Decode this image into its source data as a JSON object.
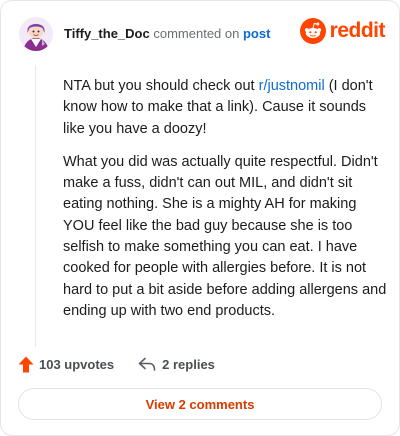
{
  "comment": {
    "username": "Tiffy_the_Doc",
    "verb": "commented on",
    "target": "post",
    "paragraph1_pre": "NTA but you should check out ",
    "paragraph1_link": "r/justnomil",
    "paragraph1_post": " (I don't know how to make that a link). Cause it sounds like you have a doozy!",
    "paragraph2": "What you did was actually quite respectful. Didn't make a fuss, didn't can out MIL, and didn't sit eating nothing. She is a mighty AH for making YOU feel like the bad guy because she is too selfish to make something you can eat. I have cooked for people with allergies before. It is not hard to put a bit aside before adding allergens and ending up with two end products."
  },
  "brand": {
    "name": "reddit",
    "color": "#ff4500",
    "icon": "reddit-snoo-icon"
  },
  "actions": {
    "upvotes_label": "103 upvotes",
    "replies_label": "2 replies",
    "upvote_icon": "upvote-arrow-icon",
    "reply_icon": "reply-arrow-icon",
    "upvote_color": "#ff4500"
  },
  "footer": {
    "view_comments_label": "View 2 comments"
  },
  "colors": {
    "link": "#0b6bd6",
    "button_text": "#d93a00"
  }
}
